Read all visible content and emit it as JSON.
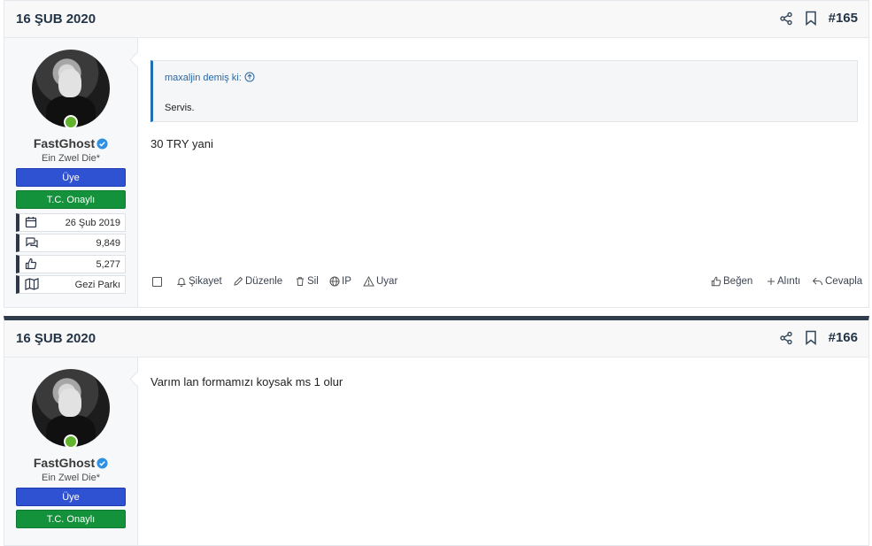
{
  "posts": [
    {
      "date": "16 ŞUB 2020",
      "number": "#165",
      "user": {
        "name": "FastGhost",
        "title": "Ein Zwel Die*",
        "badges": [
          "Üye",
          "T.C. Onaylı"
        ],
        "stats": [
          {
            "icon": "calendar-icon",
            "value": "26 Şub 2019"
          },
          {
            "icon": "messages-icon",
            "value": "9,849"
          },
          {
            "icon": "thumbs-up-icon",
            "value": "5,277"
          },
          {
            "icon": "map-icon",
            "value": "Gezi Parkı"
          }
        ]
      },
      "quote": {
        "author": "maxaljin demiş ki:",
        "text": "Servis."
      },
      "message": "30 TRY yani",
      "actions_left": [
        "Şikayet",
        "Düzenle",
        "Sil",
        "IP",
        "Uyar"
      ],
      "actions_right": [
        "Beğen",
        "Alıntı",
        "Cevapla"
      ]
    },
    {
      "date": "16 ŞUB 2020",
      "number": "#166",
      "user": {
        "name": "FastGhost",
        "title": "Ein Zwel Die*",
        "badges": [
          "Üye",
          "T.C. Onaylı"
        ]
      },
      "message": "Varım lan formamızı koysak ms 1 olur"
    }
  ],
  "colors": {
    "accent": "#1f6fb2",
    "member_badge": "#2f52d3",
    "verified_badge": "#13923b",
    "online": "#63b32e",
    "divider": "#2f3d4d"
  }
}
